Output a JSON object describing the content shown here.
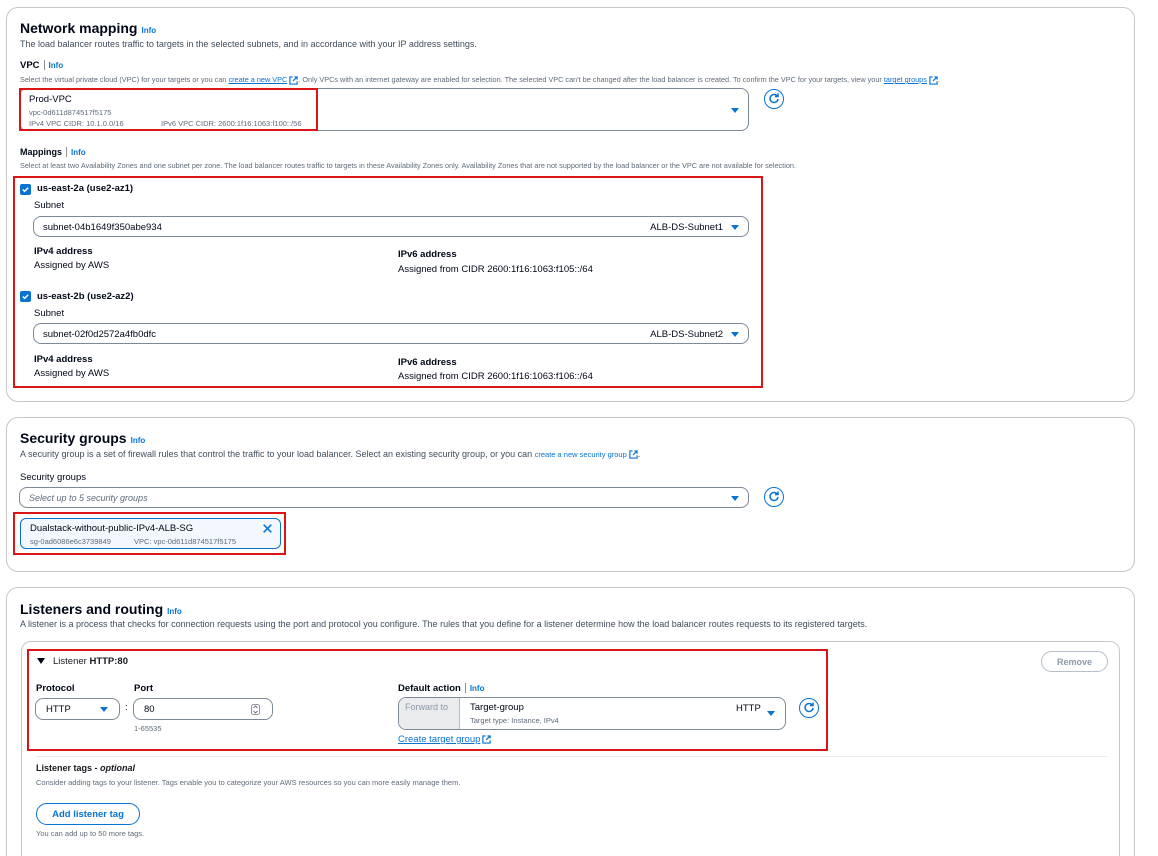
{
  "network": {
    "title": "Network mapping",
    "info": "Info",
    "desc": "The load balancer routes traffic to targets in the selected subnets, and in accordance with your IP address settings.",
    "vpc_label": "VPC",
    "vpc_info": "Info",
    "vpc_desc_1": "Select the virtual private cloud (VPC) for your targets or you can",
    "vpc_link": "create a new VPC",
    "vpc_desc_2": ". Only VPCs with an internet gateway are enabled for selection. The selected VPC can't be changed after the load balancer is created. To confirm the VPC for your targets, view your",
    "vpc_link_2": "target groups",
    "vpc_name": "Prod-VPC",
    "vpc_id": "vpc-0d611d874517f5175",
    "vpc_ipv4": "IPv4 VPC CIDR: 10.1.0.0/16",
    "vpc_ipv6": "IPv6 VPC CIDR: 2600:1f16:1063:f100::/56",
    "mappings_label": "Mappings",
    "mappings_info": "Info",
    "mappings_desc": "Select at least two Availability Zones and one subnet per zone. The load balancer routes traffic to targets in these Availability Zones only. Availability Zones that are not supported by the load balancer or the VPC are not available for selection.",
    "zones": [
      {
        "name": "us-east-2a (use2-az1)",
        "subnet_label": "Subnet",
        "subnet_id": "subnet-04b1649f350abe934",
        "subnet_name": "ALB-DS-Subnet1",
        "ipv4_label": "IPv4 address",
        "ipv4_value": "Assigned by AWS",
        "ipv6_label": "IPv6 address",
        "ipv6_value": "Assigned from CIDR 2600:1f16:1063:f105::/64"
      },
      {
        "name": "us-east-2b (use2-az2)",
        "subnet_label": "Subnet",
        "subnet_id": "subnet-02f0d2572a4fb0dfc",
        "subnet_name": "ALB-DS-Subnet2",
        "ipv4_label": "IPv4 address",
        "ipv4_value": "Assigned by AWS",
        "ipv6_label": "IPv6 address",
        "ipv6_value": "Assigned from CIDR 2600:1f16:1063:f106::/64"
      }
    ]
  },
  "security": {
    "title": "Security groups",
    "info": "Info",
    "desc": "A security group is a set of firewall rules that control the traffic to your load balancer. Select an existing security group, or you can",
    "link": "create a new security group",
    "field_label": "Security groups",
    "placeholder": "Select up to 5 security groups",
    "token_name": "Dualstack-without-public-IPv4-ALB-SG",
    "token_id": "sg-0ad6086e6c3739849",
    "token_vpc": "VPC: vpc-0d611d874517f5175"
  },
  "listeners": {
    "title": "Listeners and routing",
    "info": "Info",
    "desc": "A listener is a process that checks for connection requests using the port and protocol you configure. The rules that you define for a listener determine how the load balancer routes requests to its registered targets.",
    "listener_prefix": "Listener",
    "listener_name": "HTTP:80",
    "remove_label": "Remove",
    "protocol_label": "Protocol",
    "protocol_value": "HTTP",
    "port_label": "Port",
    "port_value": "80",
    "port_hint": "1-65535",
    "colon": ":",
    "default_action_label": "Default action",
    "default_action_info": "Info",
    "forward_to": "Forward to",
    "target_group": "Target-group",
    "target_type": "Target type: Instance, IPv4",
    "target_protocol": "HTTP",
    "create_tg": "Create target group",
    "tags_label": "Listener tags - ",
    "tags_optional": "optional",
    "tags_desc": "Consider adding tags to your listener. Tags enable you to categorize your AWS resources so you can more easily manage them.",
    "add_tag": "Add listener tag",
    "tags_hint": "You can add up to 50 more tags."
  },
  "colors": {
    "accent": "#0972d3",
    "highlight": "#d91515",
    "border": "#c6c6cd"
  }
}
